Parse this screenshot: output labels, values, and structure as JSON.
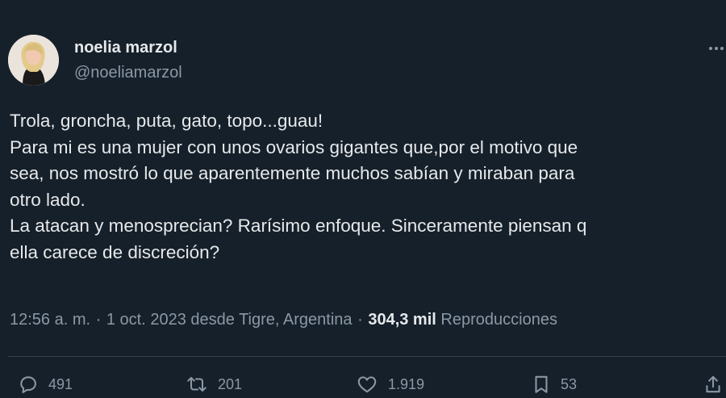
{
  "author": {
    "display_name": "noelia marzol",
    "handle": "@noeliamarzol"
  },
  "tweet": {
    "lines": [
      "Trola, groncha, puta, gato, topo...guau!",
      "Para mi es una mujer con unos ovarios gigantes que,por el motivo que",
      "sea, nos mostró lo que aparentemente muchos sabían y miraban para",
      "otro lado.",
      "La atacan y menosprecian? Rarísimo enfoque. Sinceramente piensan q",
      "ella carece de discreción?"
    ]
  },
  "meta": {
    "time": "12:56 a. m.",
    "separator": "·",
    "date": "1 oct. 2023",
    "location": "desde Tigre, Argentina",
    "views_count": "304,3 mil",
    "views_label": "Reproducciones"
  },
  "actions": {
    "replies": "491",
    "retweets": "201",
    "likes": "1.919",
    "bookmarks": "53"
  },
  "icons": {
    "reply": "speech-bubble-icon",
    "retweet": "retweet-arrows-icon",
    "like": "heart-icon",
    "bookmark": "bookmark-icon",
    "share": "share-upload-icon",
    "more": "more-dots-icon"
  },
  "colors": {
    "background": "#15202b",
    "text_primary": "#e7e9ea",
    "text_secondary": "#8b98a5",
    "divider": "#38444d"
  }
}
